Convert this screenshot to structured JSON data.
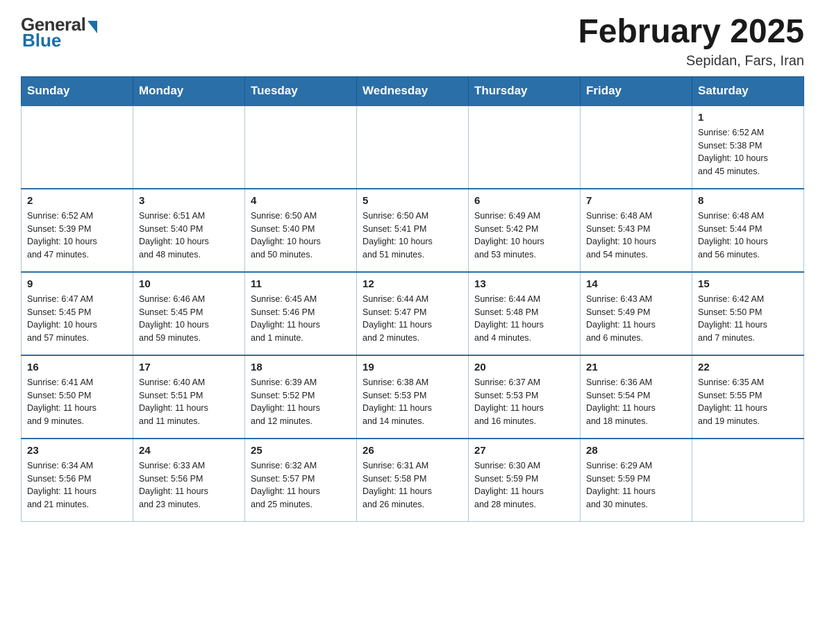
{
  "logo": {
    "general": "General",
    "blue": "Blue"
  },
  "title": {
    "month": "February 2025",
    "location": "Sepidan, Fars, Iran"
  },
  "weekdays": [
    "Sunday",
    "Monday",
    "Tuesday",
    "Wednesday",
    "Thursday",
    "Friday",
    "Saturday"
  ],
  "weeks": [
    [
      {
        "day": "",
        "info": ""
      },
      {
        "day": "",
        "info": ""
      },
      {
        "day": "",
        "info": ""
      },
      {
        "day": "",
        "info": ""
      },
      {
        "day": "",
        "info": ""
      },
      {
        "day": "",
        "info": ""
      },
      {
        "day": "1",
        "info": "Sunrise: 6:52 AM\nSunset: 5:38 PM\nDaylight: 10 hours\nand 45 minutes."
      }
    ],
    [
      {
        "day": "2",
        "info": "Sunrise: 6:52 AM\nSunset: 5:39 PM\nDaylight: 10 hours\nand 47 minutes."
      },
      {
        "day": "3",
        "info": "Sunrise: 6:51 AM\nSunset: 5:40 PM\nDaylight: 10 hours\nand 48 minutes."
      },
      {
        "day": "4",
        "info": "Sunrise: 6:50 AM\nSunset: 5:40 PM\nDaylight: 10 hours\nand 50 minutes."
      },
      {
        "day": "5",
        "info": "Sunrise: 6:50 AM\nSunset: 5:41 PM\nDaylight: 10 hours\nand 51 minutes."
      },
      {
        "day": "6",
        "info": "Sunrise: 6:49 AM\nSunset: 5:42 PM\nDaylight: 10 hours\nand 53 minutes."
      },
      {
        "day": "7",
        "info": "Sunrise: 6:48 AM\nSunset: 5:43 PM\nDaylight: 10 hours\nand 54 minutes."
      },
      {
        "day": "8",
        "info": "Sunrise: 6:48 AM\nSunset: 5:44 PM\nDaylight: 10 hours\nand 56 minutes."
      }
    ],
    [
      {
        "day": "9",
        "info": "Sunrise: 6:47 AM\nSunset: 5:45 PM\nDaylight: 10 hours\nand 57 minutes."
      },
      {
        "day": "10",
        "info": "Sunrise: 6:46 AM\nSunset: 5:45 PM\nDaylight: 10 hours\nand 59 minutes."
      },
      {
        "day": "11",
        "info": "Sunrise: 6:45 AM\nSunset: 5:46 PM\nDaylight: 11 hours\nand 1 minute."
      },
      {
        "day": "12",
        "info": "Sunrise: 6:44 AM\nSunset: 5:47 PM\nDaylight: 11 hours\nand 2 minutes."
      },
      {
        "day": "13",
        "info": "Sunrise: 6:44 AM\nSunset: 5:48 PM\nDaylight: 11 hours\nand 4 minutes."
      },
      {
        "day": "14",
        "info": "Sunrise: 6:43 AM\nSunset: 5:49 PM\nDaylight: 11 hours\nand 6 minutes."
      },
      {
        "day": "15",
        "info": "Sunrise: 6:42 AM\nSunset: 5:50 PM\nDaylight: 11 hours\nand 7 minutes."
      }
    ],
    [
      {
        "day": "16",
        "info": "Sunrise: 6:41 AM\nSunset: 5:50 PM\nDaylight: 11 hours\nand 9 minutes."
      },
      {
        "day": "17",
        "info": "Sunrise: 6:40 AM\nSunset: 5:51 PM\nDaylight: 11 hours\nand 11 minutes."
      },
      {
        "day": "18",
        "info": "Sunrise: 6:39 AM\nSunset: 5:52 PM\nDaylight: 11 hours\nand 12 minutes."
      },
      {
        "day": "19",
        "info": "Sunrise: 6:38 AM\nSunset: 5:53 PM\nDaylight: 11 hours\nand 14 minutes."
      },
      {
        "day": "20",
        "info": "Sunrise: 6:37 AM\nSunset: 5:53 PM\nDaylight: 11 hours\nand 16 minutes."
      },
      {
        "day": "21",
        "info": "Sunrise: 6:36 AM\nSunset: 5:54 PM\nDaylight: 11 hours\nand 18 minutes."
      },
      {
        "day": "22",
        "info": "Sunrise: 6:35 AM\nSunset: 5:55 PM\nDaylight: 11 hours\nand 19 minutes."
      }
    ],
    [
      {
        "day": "23",
        "info": "Sunrise: 6:34 AM\nSunset: 5:56 PM\nDaylight: 11 hours\nand 21 minutes."
      },
      {
        "day": "24",
        "info": "Sunrise: 6:33 AM\nSunset: 5:56 PM\nDaylight: 11 hours\nand 23 minutes."
      },
      {
        "day": "25",
        "info": "Sunrise: 6:32 AM\nSunset: 5:57 PM\nDaylight: 11 hours\nand 25 minutes."
      },
      {
        "day": "26",
        "info": "Sunrise: 6:31 AM\nSunset: 5:58 PM\nDaylight: 11 hours\nand 26 minutes."
      },
      {
        "day": "27",
        "info": "Sunrise: 6:30 AM\nSunset: 5:59 PM\nDaylight: 11 hours\nand 28 minutes."
      },
      {
        "day": "28",
        "info": "Sunrise: 6:29 AM\nSunset: 5:59 PM\nDaylight: 11 hours\nand 30 minutes."
      },
      {
        "day": "",
        "info": ""
      }
    ]
  ]
}
